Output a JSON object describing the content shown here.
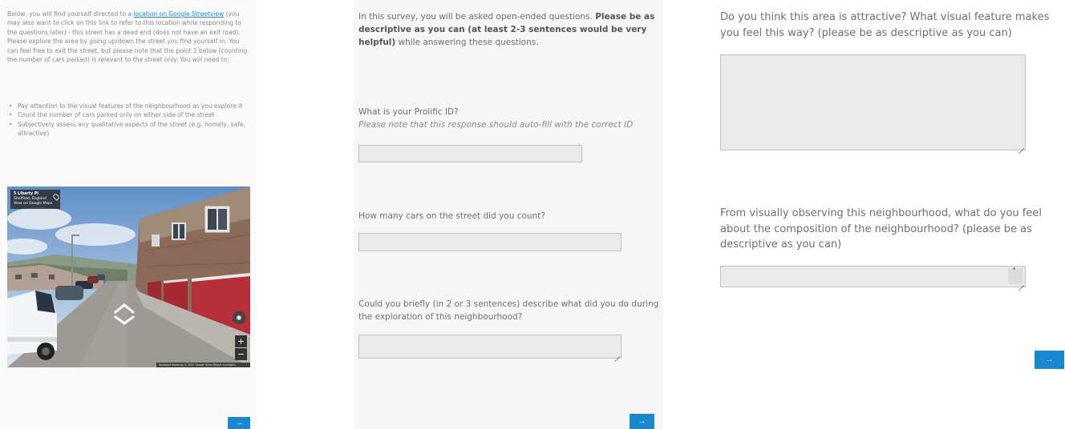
{
  "panel1": {
    "intro_before_link": "Below, you will find yourself directed to a ",
    "link_text": "location on Google Streetview",
    "intro_after_link": " (you may also want to click on this link to refer to this location while responding to the questions later) - this street has a dead end (does not have an exit road). Please explore the area by going up/down the street you find yourself in. You can feel free to exit the street, but please note that the point 2 below (counting the number of cars parked) is relevant to the street only. You will need to:",
    "bullets": [
      "Pay attention to the visual features of the neighbourhood as you explore it",
      "Count the number of cars parked only on either side of the street",
      "Subjectively assess any qualitative aspects of the street (e.g. homely, safe, attractive)"
    ],
    "streetview": {
      "address": "5 Liberty Pl",
      "city": "Sheffield, England",
      "view_link": "View on Google Maps",
      "zoom_in": "+",
      "zoom_out": "−",
      "footer": "Keyboard shortcuts   © 2024 Google   Terms   Report a problem"
    },
    "next_label": "→"
  },
  "panel2": {
    "intro_plain_1": "In this survey, you will be asked open-ended questions. ",
    "intro_bold": "Please be as descriptive as you can (at least 2-3 sentences would be very helpful)",
    "intro_plain_2": " while answering these questions.",
    "q1_label": "What is your Prolific ID?",
    "q1_note": "Please note that this response should auto-fill with the correct ID",
    "q2_label": "How many cars on the street did you count?",
    "q3_label": "Could you briefly (in 2 or 3 sentences) describe what did you do during the exploration of this neighbourhood?",
    "next_label": "→"
  },
  "panel3": {
    "q4_label": "Do you think this area is attractive? What visual feature makes you feel this way? (please be as descriptive as you can)",
    "q5_label": "From visually observing this neighbourhood, what do you feel about the composition of the neighbourhood? (please be as descriptive as you can)",
    "next_label": "→"
  },
  "colors": {
    "accent": "#1a88cf",
    "link": "#1e88c9",
    "field_bg": "#eaeaea",
    "field_border": "#c2c2c2"
  }
}
